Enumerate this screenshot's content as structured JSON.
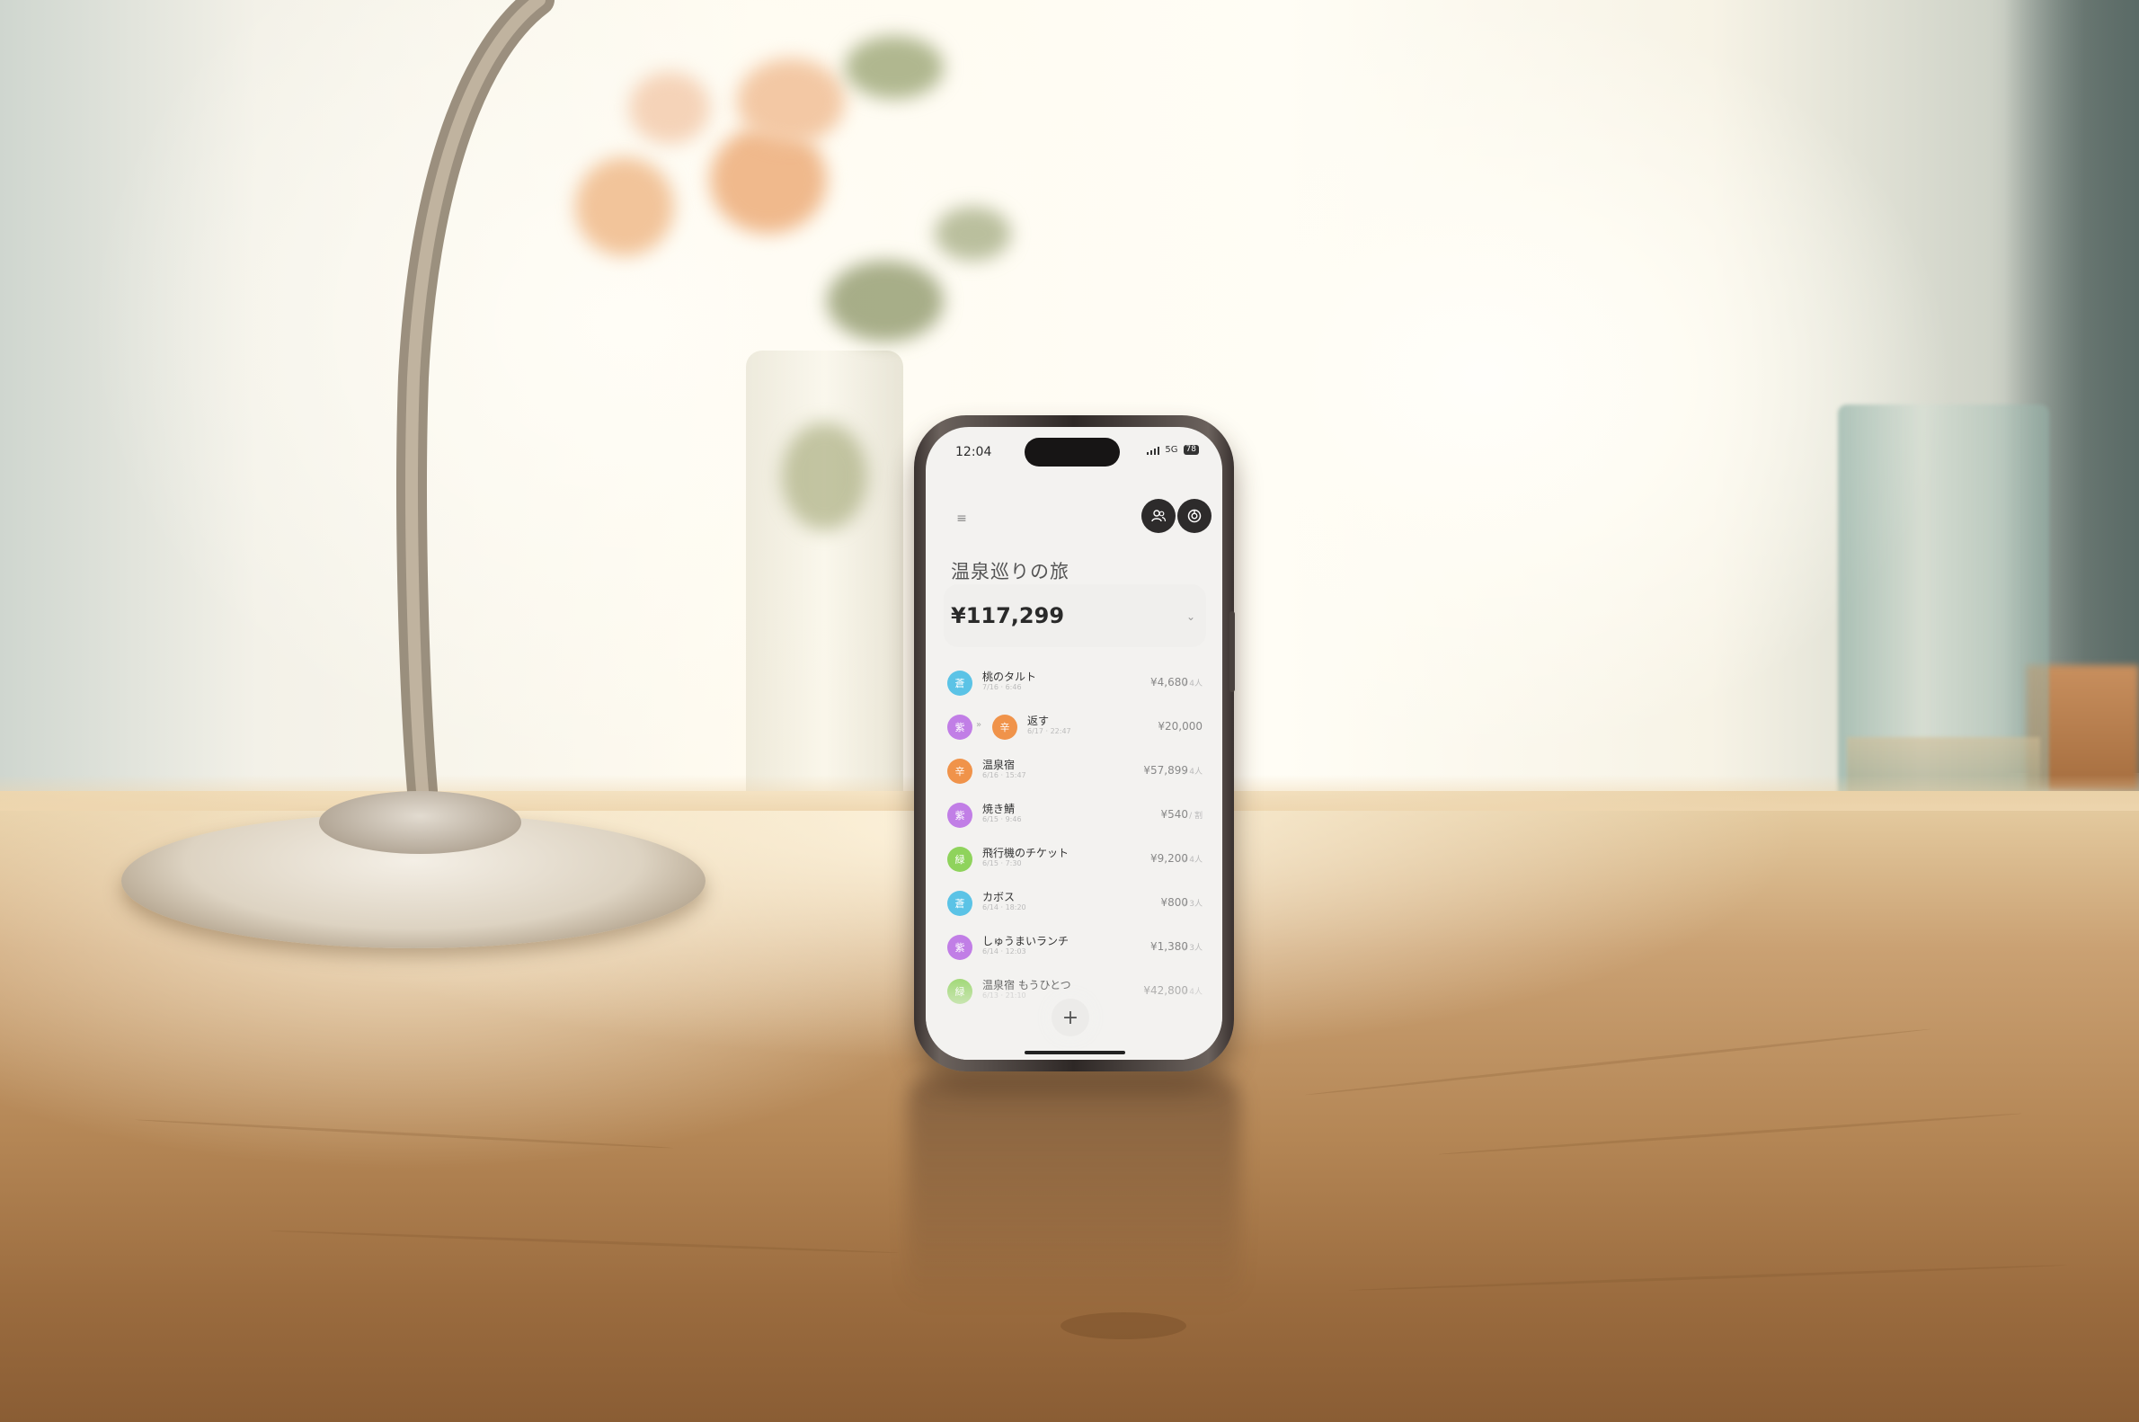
{
  "phone": {
    "status": {
      "time": "12:04",
      "network": "5G",
      "battery": "78"
    },
    "trip_title": "温泉巡りの旅",
    "total": "¥117,299",
    "menu_icon": "menu-icon",
    "buttons": {
      "members_icon": "people-icon",
      "stats_icon": "chart-icon"
    },
    "add_label": "+",
    "expenses": [
      {
        "avatar": "蒼",
        "color": "#5bc3e6",
        "name": "桃のタルト",
        "sub": "7/16 · 6:46",
        "amount": "¥4,680",
        "per": "/ 4人"
      },
      {
        "avatar": "紫",
        "color": "#c17ee6",
        "avatar2": "辛",
        "color2": "#f0934a",
        "arrow": "»",
        "name": "返す",
        "sub": "6/17 · 22:47",
        "amount": "¥20,000",
        "per": ""
      },
      {
        "avatar": "辛",
        "color": "#f0934a",
        "name": "温泉宿",
        "sub": "6/16 · 15:47",
        "amount": "¥57,899",
        "per": "/ 4人"
      },
      {
        "avatar": "紫",
        "color": "#c17ee6",
        "name": "焼き鯖",
        "sub": "6/15 · 9:46",
        "amount": "¥540",
        "per": "/ 割"
      },
      {
        "avatar": "緑",
        "color": "#8fd35c",
        "name": "飛行機のチケット",
        "sub": "6/15 · 7:30",
        "amount": "¥9,200",
        "per": "/ 4人"
      },
      {
        "avatar": "蒼",
        "color": "#5bc3e6",
        "name": "カボス",
        "sub": "6/14 · 18:20",
        "amount": "¥800",
        "per": "/ 3人"
      },
      {
        "avatar": "紫",
        "color": "#c17ee6",
        "name": "しゅうまいランチ",
        "sub": "6/14 · 12:03",
        "amount": "¥1,380",
        "per": "/ 3人"
      },
      {
        "avatar": "緑",
        "color": "#8fd35c",
        "name": "温泉宿 もうひとつ",
        "sub": "6/13 · 21:10",
        "amount": "¥42,800",
        "per": "/ 4人"
      }
    ]
  }
}
